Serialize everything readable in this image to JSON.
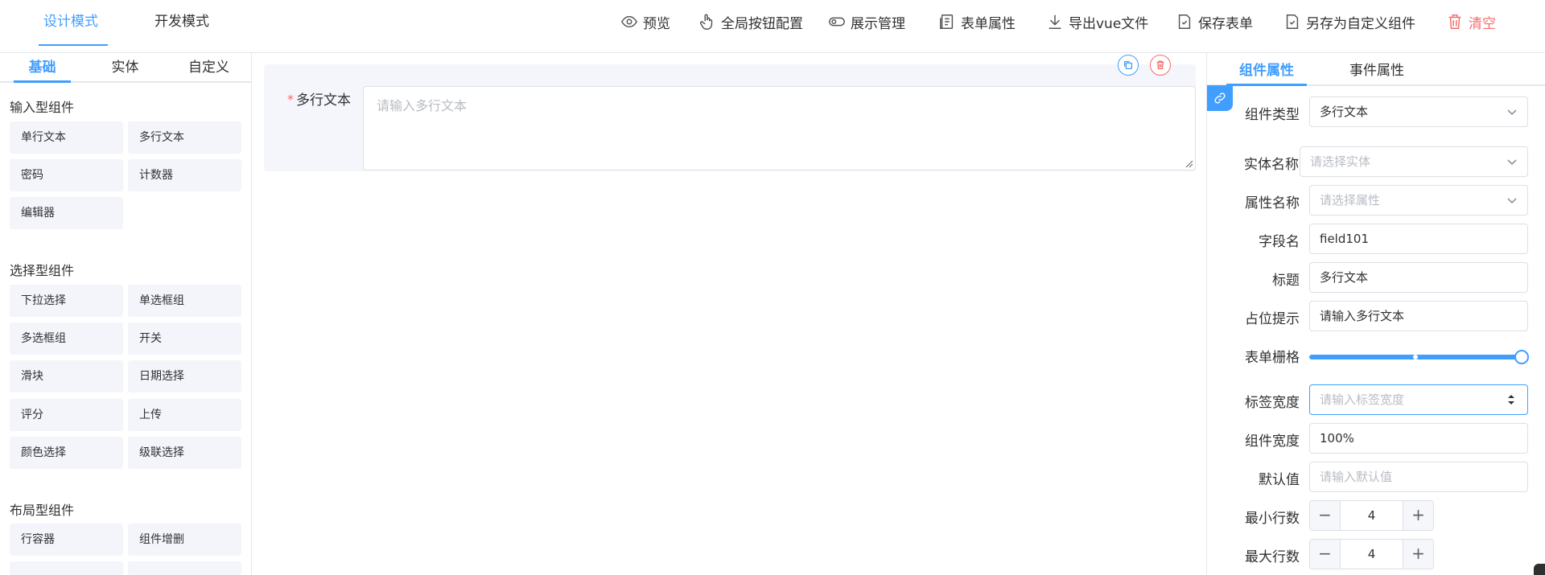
{
  "header": {
    "modes": [
      {
        "label": "设计模式",
        "active": true
      },
      {
        "label": "开发模式",
        "active": false
      }
    ],
    "toolbar": {
      "preview": "预览",
      "global_button_config": "全局按钮配置",
      "display_manage": "展示管理",
      "form_props": "表单属性",
      "export_vue": "导出vue文件",
      "save_form": "保存表单",
      "save_as_custom": "另存为自定义组件",
      "clear": "清空"
    }
  },
  "left": {
    "tabs": [
      "基础",
      "实体",
      "自定义"
    ],
    "active_tab": "基础",
    "groups": [
      {
        "title": "输入型组件",
        "items": [
          "单行文本",
          "多行文本",
          "密码",
          "计数器",
          "编辑器"
        ]
      },
      {
        "title": "选择型组件",
        "items": [
          "下拉选择",
          "单选框组",
          "多选框组",
          "开关",
          "滑块",
          "日期选择",
          "评分",
          "上传",
          "颜色选择",
          "级联选择"
        ]
      },
      {
        "title": "布局型组件",
        "items": [
          "行容器",
          "组件增删"
        ]
      }
    ]
  },
  "canvas": {
    "field": {
      "required": true,
      "star": "*",
      "label": "多行文本",
      "placeholder": "请输入多行文本"
    }
  },
  "right": {
    "tabs": [
      "组件属性",
      "事件属性"
    ],
    "active_tab": "组件属性",
    "props": {
      "component_type": {
        "label": "组件类型",
        "value": "多行文本"
      },
      "entity_name": {
        "label": "实体名称",
        "placeholder": "请选择实体"
      },
      "attr_name": {
        "label": "属性名称",
        "placeholder": "请选择属性"
      },
      "field_name": {
        "label": "字段名",
        "value": "field101"
      },
      "title": {
        "label": "标题",
        "value": "多行文本"
      },
      "placeholder_hint": {
        "label": "占位提示",
        "value": "请输入多行文本"
      },
      "grid": {
        "label": "表单栅格",
        "value_fraction": 1.0
      },
      "label_width": {
        "label": "标签宽度",
        "placeholder": "请输入标签宽度"
      },
      "component_width": {
        "label": "组件宽度",
        "value": "100%"
      },
      "default_value": {
        "label": "默认值",
        "placeholder": "请输入默认值"
      },
      "min_rows": {
        "label": "最小行数",
        "value": "4",
        "minus": "−",
        "plus": "+"
      },
      "max_rows": {
        "label": "最大行数",
        "value": "4",
        "minus": "−",
        "plus": "+"
      }
    }
  },
  "colors": {
    "accent": "#409eff",
    "danger": "#f56c6c",
    "component_bg": "#f3f5fb"
  }
}
